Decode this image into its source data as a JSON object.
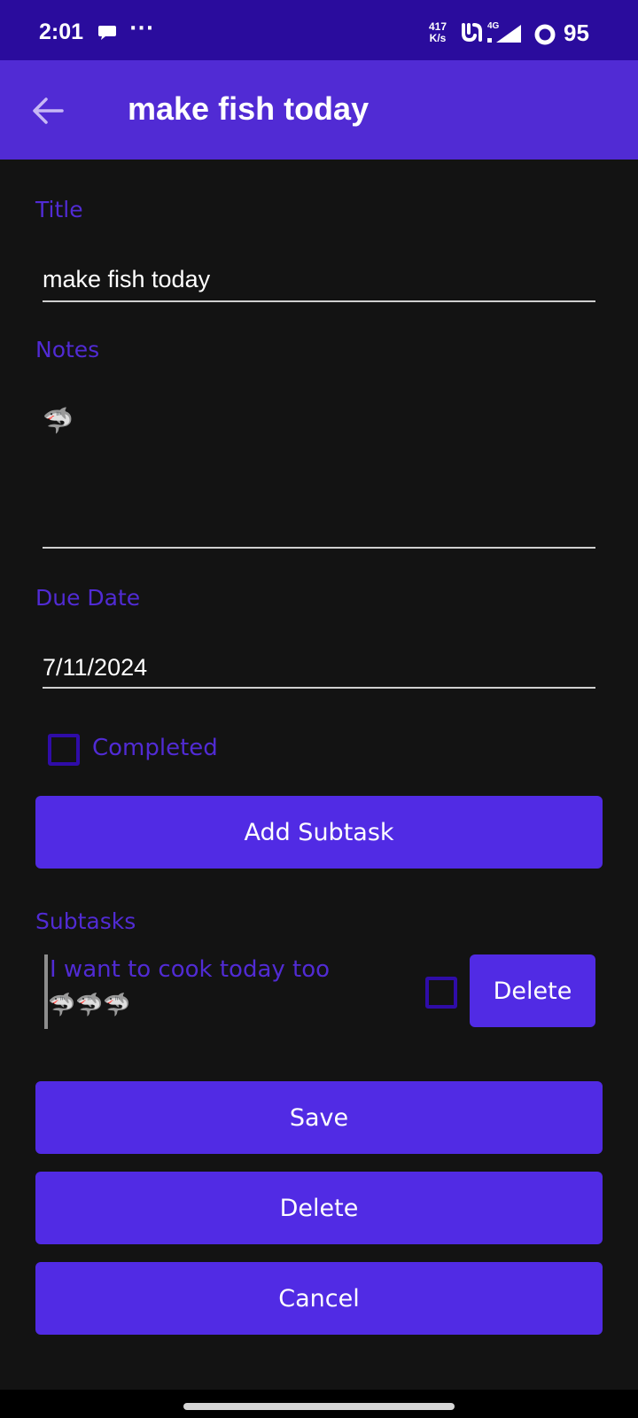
{
  "status_bar": {
    "time": "2:01",
    "more": "···",
    "net_speed_value": "417",
    "net_speed_unit": "K/s",
    "network_type": "4G",
    "battery": "95"
  },
  "app_bar": {
    "title": "make fish today",
    "back_icon": "arrow-left-icon"
  },
  "form": {
    "title_label": "Title",
    "title_value": "make fish today",
    "notes_label": "Notes",
    "notes_value": "🦈",
    "due_date_label": "Due Date",
    "due_date_value": "7/11/2024",
    "completed_label": "Completed",
    "completed_checked": false,
    "add_subtask_label": "Add Subtask",
    "subtasks_label": "Subtasks"
  },
  "subtasks": [
    {
      "title": "I want to cook today too",
      "notes": "🦈🦈🦈",
      "checked": false,
      "delete_label": "Delete"
    }
  ],
  "actions": {
    "save_label": "Save",
    "delete_label": "Delete",
    "cancel_label": "Cancel"
  },
  "colors": {
    "status_bar": "#2a0c9d",
    "app_bar": "#512bd4",
    "accent": "#512be4",
    "background": "#131313"
  }
}
